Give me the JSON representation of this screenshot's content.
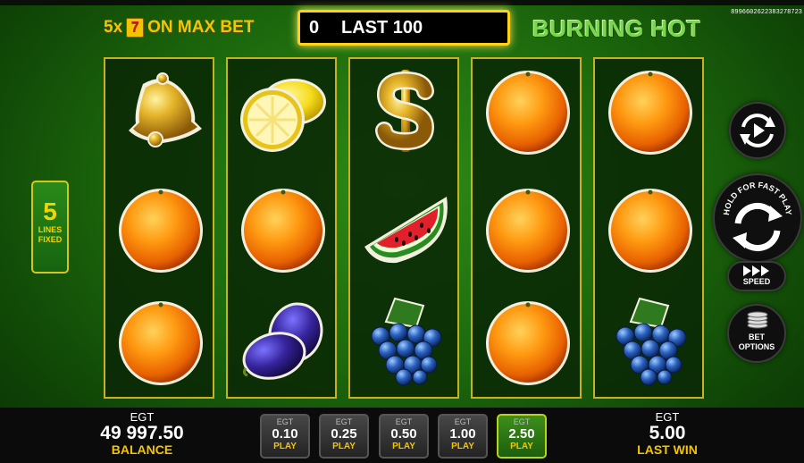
{
  "header": {
    "multiplier": "5x",
    "seven_symbol": "7",
    "max_bet_text": "ON MAX BET",
    "last_count": "0",
    "last_label": "LAST 100",
    "game_title": "BURNING HOT",
    "round_code": "8996602622383278723"
  },
  "lines": {
    "count": "5",
    "label_line1": "LINES",
    "label_line2": "FIXED"
  },
  "reels": [
    [
      "bell",
      "orange",
      "orange"
    ],
    [
      "lemon",
      "orange",
      "plum"
    ],
    [
      "dollar",
      "watermelon",
      "grapes"
    ],
    [
      "orange",
      "orange",
      "orange"
    ],
    [
      "orange",
      "orange",
      "grapes"
    ]
  ],
  "controls": {
    "autoplay_icon": "autoplay-icon",
    "spin_label": "HOLD FOR FAST PLAY",
    "speed_label": "SPEED",
    "bet_options_line1": "BET",
    "bet_options_line2": "OPTIONS"
  },
  "footer": {
    "balance_currency": "EGT",
    "balance_value": "49 997.50",
    "balance_label": "BALANCE",
    "last_win_currency": "EGT",
    "last_win_value": "5.00",
    "last_win_label": "LAST WIN",
    "bets": [
      {
        "currency": "EGT",
        "value": "0.10",
        "label": "PLAY"
      },
      {
        "currency": "EGT",
        "value": "0.25",
        "label": "PLAY"
      },
      {
        "currency": "EGT",
        "value": "0.50",
        "label": "PLAY"
      },
      {
        "currency": "EGT",
        "value": "1.00",
        "label": "PLAY"
      },
      {
        "currency": "EGT",
        "value": "2.50",
        "label": "PLAY"
      }
    ],
    "active_bet_index": 4
  },
  "colors": {
    "gold": "#f5c400",
    "green_bg": "#1d6a0d",
    "reel_frame": "#c7b21e",
    "active_bet": "#3c8f1c"
  }
}
